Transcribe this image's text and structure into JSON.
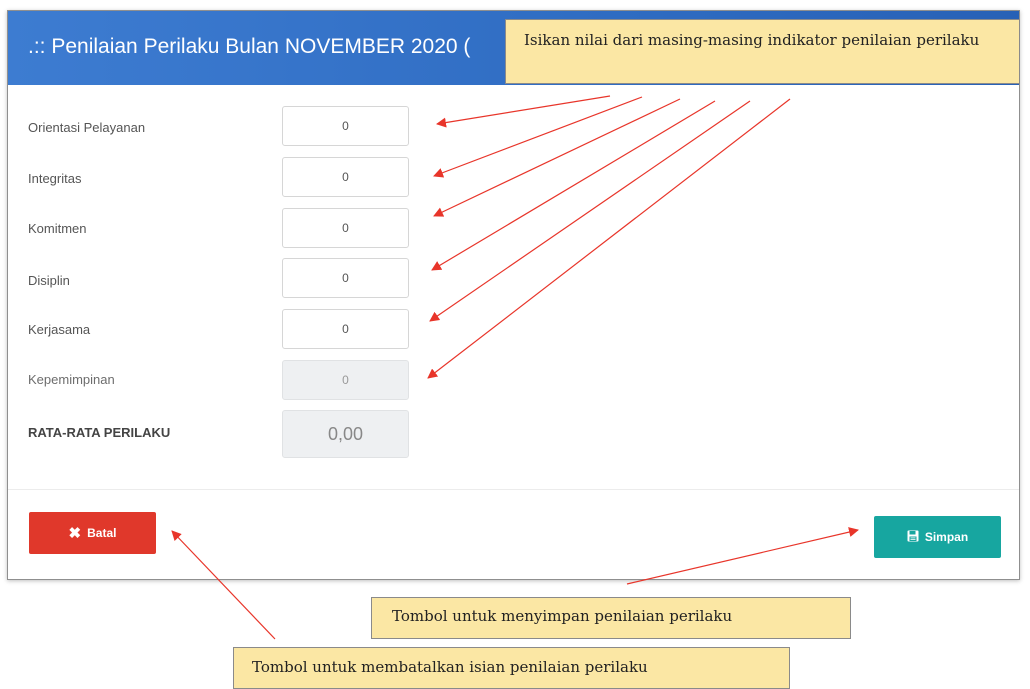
{
  "modal": {
    "title": ".:: Penilaian Perilaku Bulan NOVEMBER 2020 ("
  },
  "form": {
    "fields": [
      {
        "label": "Orientasi Pelayanan",
        "value": "0"
      },
      {
        "label": "Integritas",
        "value": "0"
      },
      {
        "label": "Komitmen",
        "value": "0"
      },
      {
        "label": "Disiplin",
        "value": "0"
      },
      {
        "label": "Kerjasama",
        "value": "0"
      },
      {
        "label": "Kepemimpinan",
        "value": "0"
      }
    ],
    "average": {
      "label": "RATA-RATA PERILAKU",
      "value": "0,00"
    }
  },
  "footer": {
    "cancel_label": "Batal",
    "save_label": "Simpan"
  },
  "callouts": {
    "indicator": "Isikan nilai dari masing-masing indikator penilaian perilaku",
    "save": "Tombol untuk menyimpan penilaian perilaku",
    "cancel": "Tombol untuk membatalkan isian penilaian perilaku"
  },
  "colors": {
    "header": "#2f6cc2",
    "cancel_button": "#e0382b",
    "save_button": "#17a6a0",
    "callout": "#fbe7a4",
    "arrow": "#e8352a"
  },
  "icons": {
    "cancel": "close-icon",
    "save": "floppy-disk-icon"
  }
}
